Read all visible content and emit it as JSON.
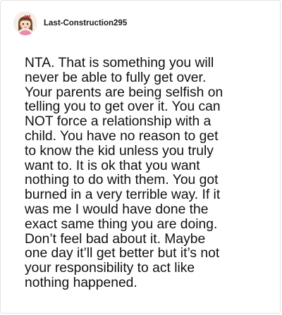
{
  "post": {
    "username": "Last-Construction295",
    "avatar_icon": "cartoon-girl-avatar",
    "comment": "NTA. That is something you will\nnever be able to fully get over.\nYour parents are being selfish on\ntelling you to get over it. You can\nNOT force a relationship with a\nchild. You have no reason to get\nto know the kid unless you truly\nwant to. It is ok that you want\nnothing to do with them. You got\nburned in a very terrible way. If it\nwas me I would have done the\nexact same thing you are doing.\nDon’t feel bad about it. Maybe\none day it’ll get better but it’s not\nyour responsibility to act like\nnothing happened."
  }
}
